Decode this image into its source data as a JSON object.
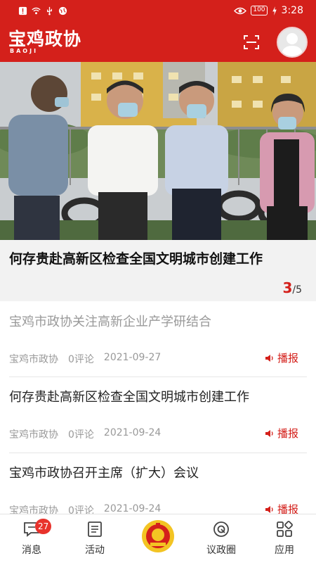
{
  "status_bar": {
    "time": "3:28",
    "battery": "100",
    "icons": [
      "alert-icon",
      "wifi-icon",
      "usb-icon",
      "globe-icon",
      "eye-icon",
      "charging-icon"
    ]
  },
  "header": {
    "logo_text": "宝鸡政协",
    "logo_sub": "BAOJI",
    "scan_icon": "scan-icon",
    "avatar_icon": "user-avatar"
  },
  "hero": {
    "title": "何存贵赴高新区检查全国文明城市创建工作",
    "pager_current": "3",
    "pager_total": "/5"
  },
  "news": [
    {
      "title": "宝鸡市政协关注高新企业产学研结合",
      "source": "宝鸡市政协",
      "comments": "0评论",
      "date": "2021-09-27",
      "speak_label": "播报"
    },
    {
      "title": "何存贵赴高新区检查全国文明城市创建工作",
      "source": "宝鸡市政协",
      "comments": "0评论",
      "date": "2021-09-24",
      "speak_label": "播报"
    },
    {
      "title": "宝鸡市政协召开主席（扩大）会议",
      "source": "宝鸡市政协",
      "comments": "0评论",
      "date": "2021-09-24",
      "speak_label": "播报"
    }
  ],
  "tabbar": {
    "messages": {
      "label": "消息",
      "badge": "27",
      "icon": "chat-icon"
    },
    "activity": {
      "label": "活动",
      "icon": "document-icon"
    },
    "home": {
      "icon": "cppcc-emblem-icon"
    },
    "circle": {
      "label": "议政圈",
      "icon": "circle-icon"
    },
    "apps": {
      "label": "应用",
      "icon": "grid-icon"
    }
  },
  "colors": {
    "brand_red": "#d4201b",
    "badge_red": "#e8322c",
    "read_gray": "#999999"
  }
}
